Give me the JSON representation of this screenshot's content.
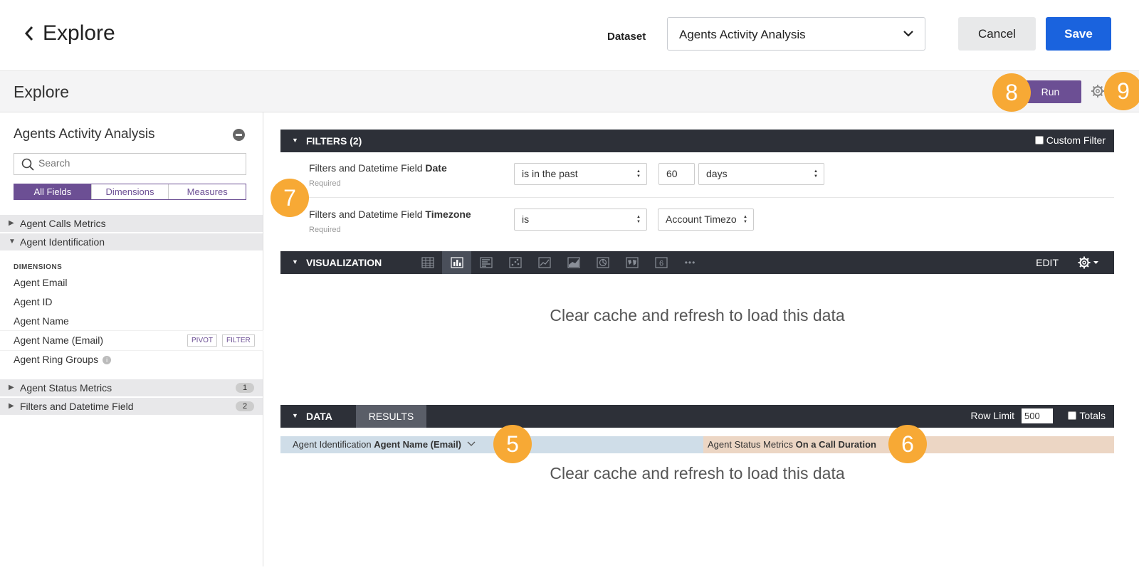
{
  "header": {
    "back_title": "Explore",
    "dataset_label": "Dataset",
    "dataset_value": "Agents Activity Analysis",
    "cancel_label": "Cancel",
    "save_label": "Save"
  },
  "subbar": {
    "title": "Explore",
    "run_label": "Run"
  },
  "badges": [
    "5",
    "6",
    "7",
    "8",
    "9"
  ],
  "sidebar": {
    "title": "Agents Activity Analysis",
    "search_placeholder": "Search",
    "segments": [
      "All Fields",
      "Dimensions",
      "Measures"
    ],
    "groups": [
      {
        "label": "Agent Calls Metrics",
        "count": ""
      },
      {
        "label": "Agent Identification",
        "count": ""
      },
      {
        "label": "Agent Status Metrics",
        "count": "1"
      },
      {
        "label": "Filters and Datetime Field",
        "count": "2"
      }
    ],
    "dimensions_header": "DIMENSIONS",
    "fields": [
      "Agent Email",
      "Agent ID",
      "Agent Name",
      "Agent Name (Email)",
      "Agent Ring Groups"
    ],
    "pivot_label": "PIVOT",
    "filter_label": "FILTER",
    "info_glyph": "i"
  },
  "filters": {
    "title": "FILTERS (2)",
    "custom_filter": "Custom Filter",
    "rows": [
      {
        "prefix": "Filters and Datetime Field",
        "name": "Date",
        "required": "Required",
        "op": "is in the past",
        "value": "60",
        "unit": "days"
      },
      {
        "prefix": "Filters and Datetime Field",
        "name": "Timezone",
        "required": "Required",
        "op": "is",
        "value": "Account Timezo"
      }
    ]
  },
  "visualization": {
    "title": "VISUALIZATION",
    "edit_label": "EDIT",
    "icons": [
      "table-icon",
      "column-chart-icon",
      "bar-chart-icon",
      "scatter-icon",
      "line-chart-icon",
      "area-chart-icon",
      "pie-chart-icon",
      "map-icon",
      "single-value-icon",
      "more-icon"
    ],
    "single_value_glyph": "6",
    "more_glyph": "•••",
    "message": "Clear cache and refresh to load this data"
  },
  "data": {
    "title": "DATA",
    "results_tab": "RESULTS",
    "row_limit_label": "Row Limit",
    "row_limit_value": "500",
    "totals_label": "Totals",
    "col1_prefix": "Agent Identification",
    "col1_name": "Agent Name (Email)",
    "col2_prefix": "Agent Status Metrics",
    "col2_name": "On a Call Duration",
    "message": "Clear cache and refresh to load this data"
  },
  "colors": {
    "accent": "#6c4f94",
    "save_blue": "#1a63de",
    "badge": "#f7a935",
    "dark_bar": "#2d3038"
  }
}
